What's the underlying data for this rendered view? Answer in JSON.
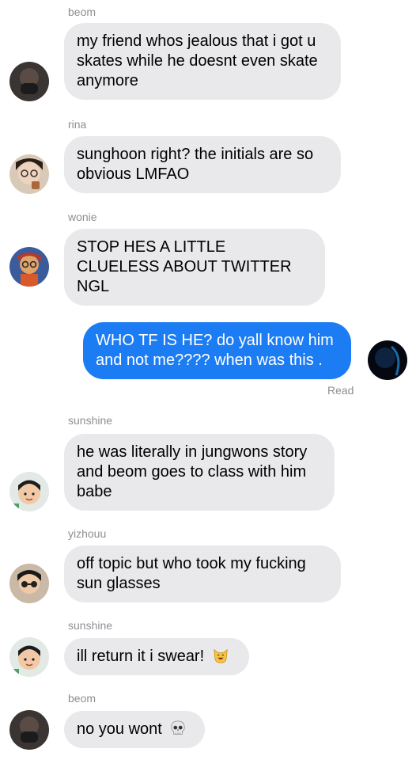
{
  "messages": [
    {
      "sender": "beom",
      "text": "my friend whos jealous that i got u skates while he doesnt even skate anymore"
    },
    {
      "sender": "rina",
      "text": "sunghoon right? the initials are so obvious LMFAO"
    },
    {
      "sender": "wonie",
      "text": "STOP HES A LITTLE CLUELESS ABOUT TWITTER NGL"
    },
    {
      "sender": "me",
      "text": "WHO TF IS HE? do yall know him and not me???? when was this ."
    },
    {
      "sender": "sunshine",
      "text": "he was literally in jungwons story and beom goes to class with him babe"
    },
    {
      "sender": "yizhouu",
      "text": "off topic but who took my fucking sun glasses"
    },
    {
      "sender": "sunshine",
      "text": "ill return it i swear!",
      "emoji": "smiling-cat-emoji"
    },
    {
      "sender": "beom",
      "text": "no you wont",
      "emoji": "skull-emoji"
    }
  ],
  "read_receipt": "Read",
  "colors": {
    "outgoing_bubble": "#1c7cf4",
    "incoming_bubble": "#e9e9eb",
    "meta_text": "#8e8e93"
  }
}
